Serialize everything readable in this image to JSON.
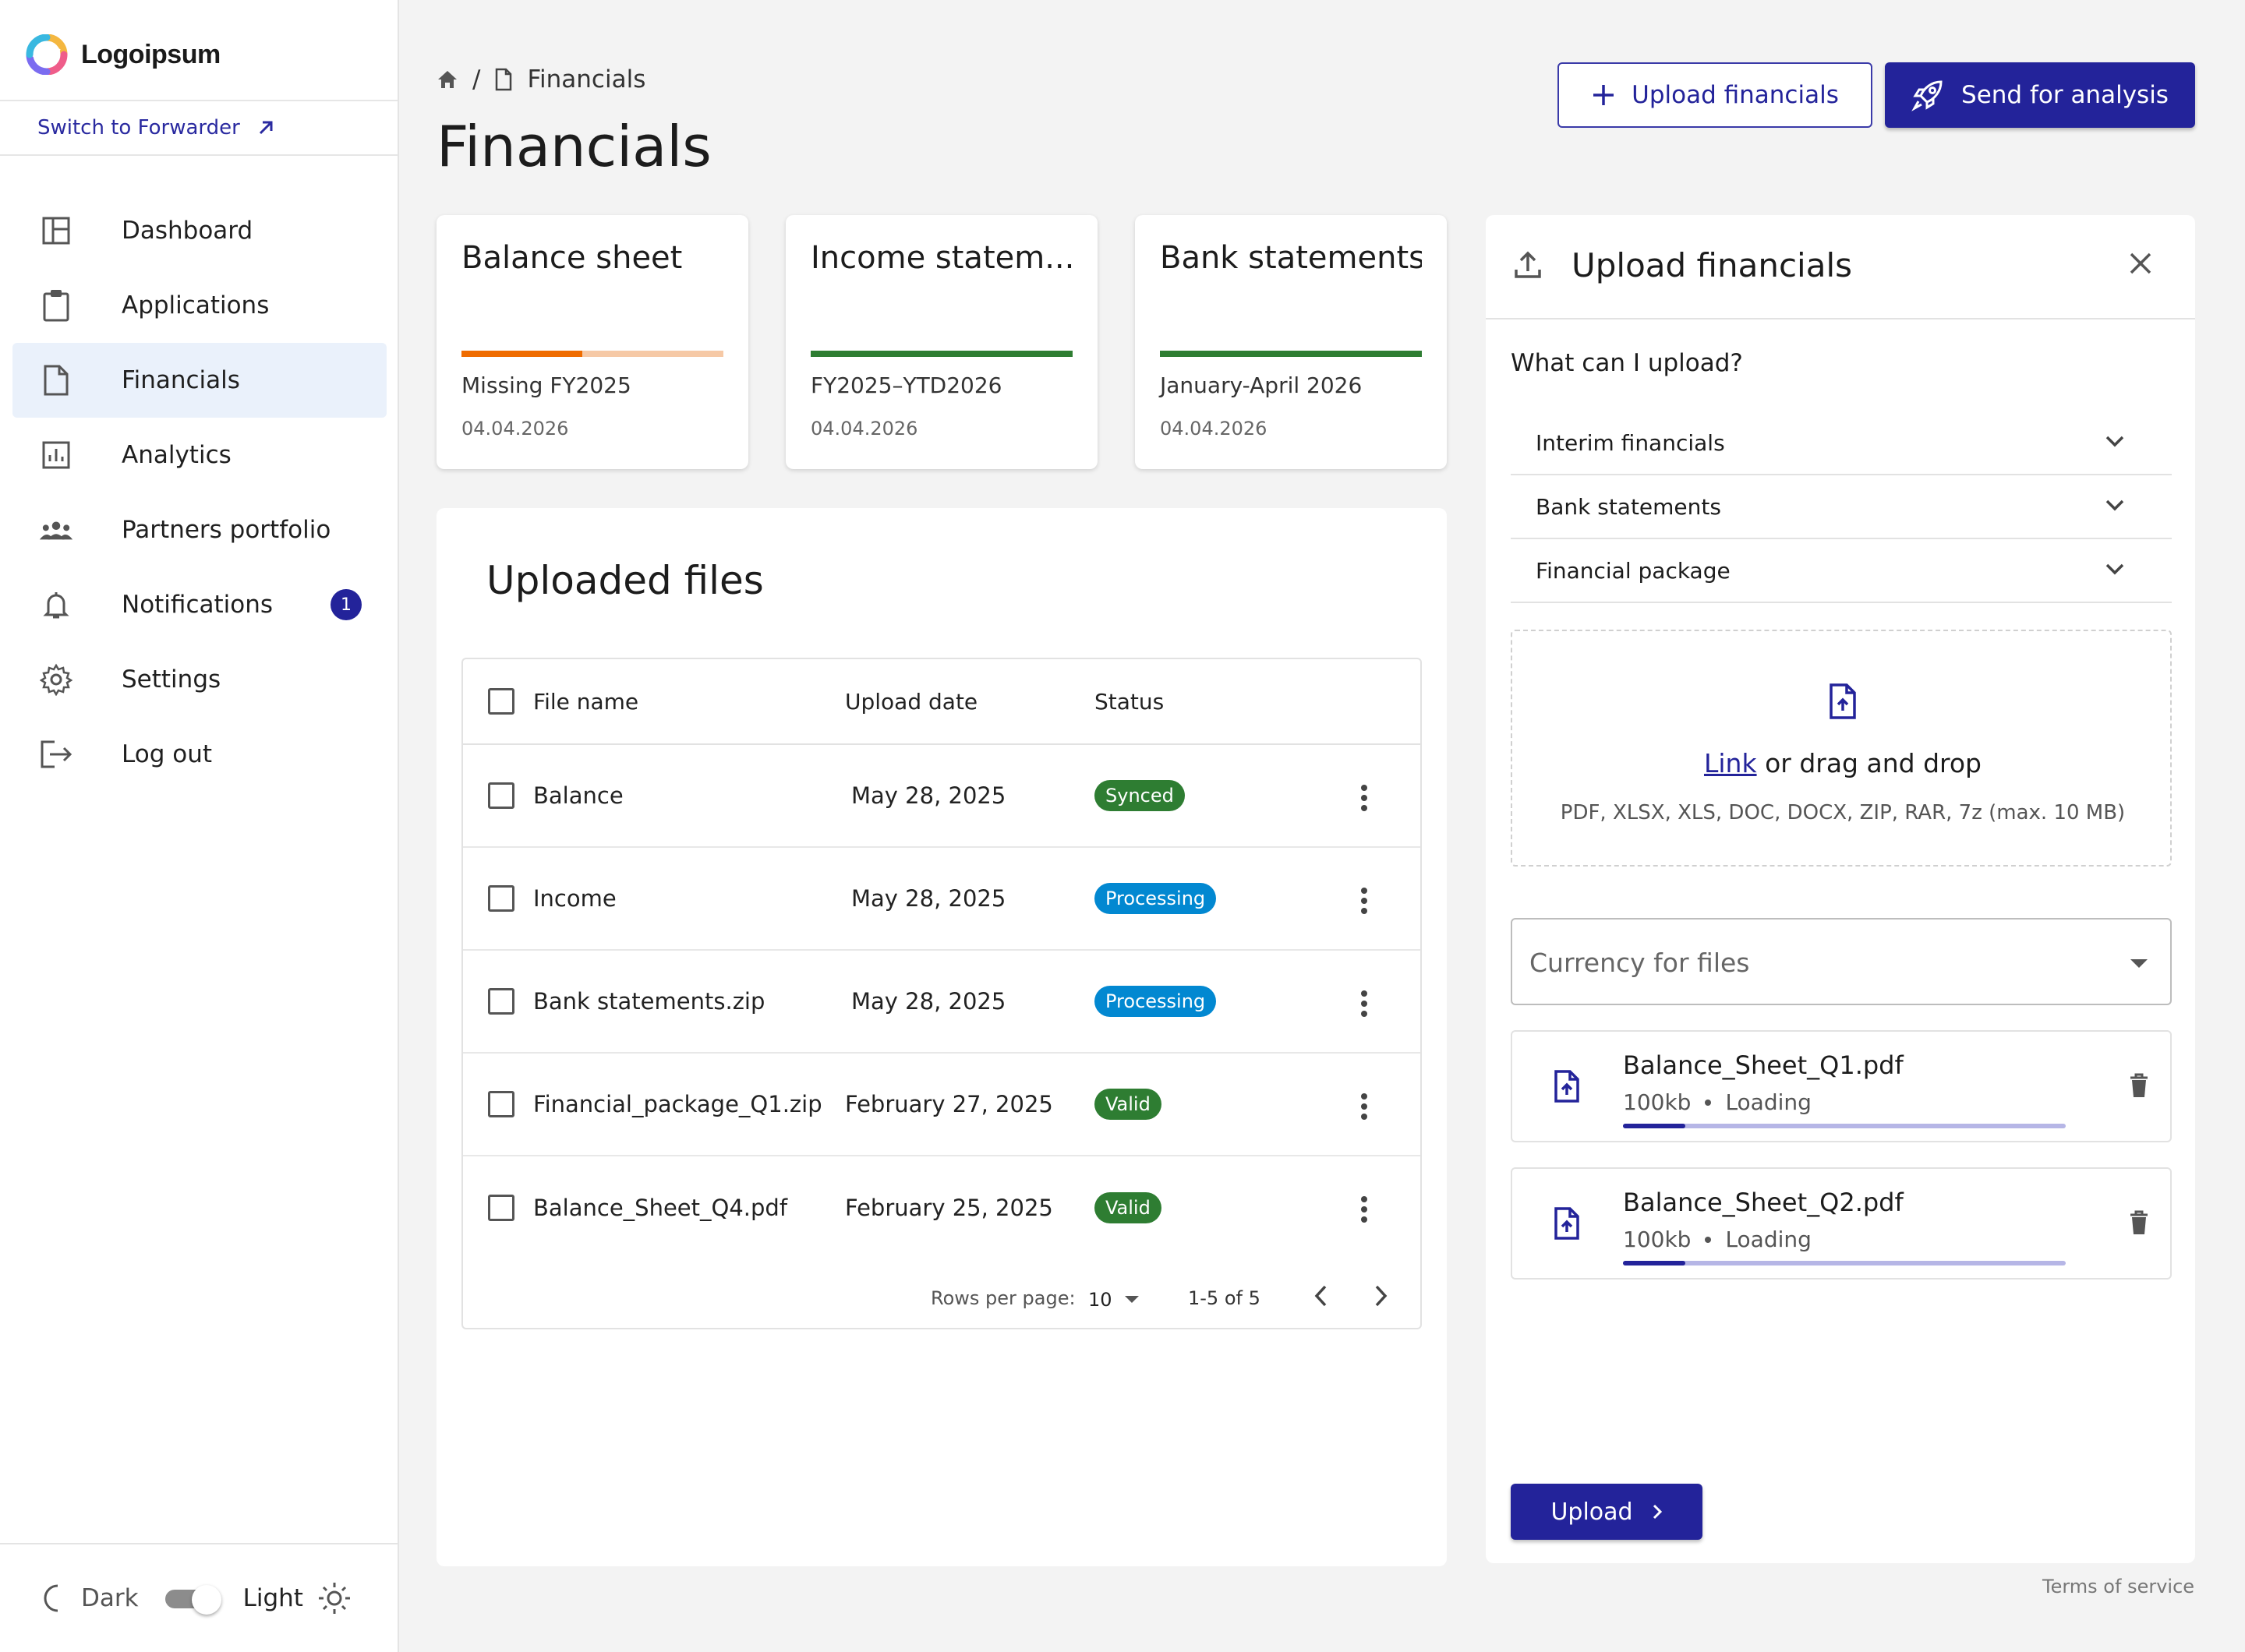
{
  "brand": {
    "name": "Logoipsum"
  },
  "sidebar": {
    "switch_label": "Switch to Forwarder",
    "items": [
      {
        "label": "Dashboard",
        "icon": "dashboard-icon"
      },
      {
        "label": "Applications",
        "icon": "clipboard-icon"
      },
      {
        "label": "Financials",
        "icon": "document-icon",
        "active": true
      },
      {
        "label": "Analytics",
        "icon": "analytics-icon"
      },
      {
        "label": "Partners portfolio",
        "icon": "group-icon"
      },
      {
        "label": "Notifications",
        "icon": "bell-icon",
        "badge": "1"
      },
      {
        "label": "Settings",
        "icon": "gear-icon"
      },
      {
        "label": "Log out",
        "icon": "logout-icon"
      }
    ],
    "theme": {
      "dark_label": "Dark",
      "light_label": "Light"
    }
  },
  "header": {
    "breadcrumb_sep": "/",
    "breadcrumb_current": "Financials",
    "title": "Financials",
    "upload_button": "Upload financials",
    "send_button": "Send for analysis"
  },
  "cards": [
    {
      "title": "Balance sheet",
      "subtitle": "Missing FY2025",
      "date": "04.04.2026",
      "progress": 0.46,
      "color": "#ef6c00"
    },
    {
      "title": "Income statem...",
      "subtitle": "FY2025–YTD2026",
      "date": "04.04.2026",
      "progress": 1.0,
      "color": "#2e7d32"
    },
    {
      "title": "Bank statements",
      "subtitle": "January-April 2026",
      "date": "04.04.2026",
      "progress": 1.0,
      "color": "#2e7d32"
    }
  ],
  "files": {
    "title": "Uploaded files",
    "columns": {
      "name": "File name",
      "date": "Upload date",
      "status": "Status"
    },
    "rows": [
      {
        "name": "Balance",
        "date": "May 28, 2025",
        "status": "Synced"
      },
      {
        "name": "Income",
        "date": "May 28, 2025",
        "status": "Processing"
      },
      {
        "name": "Bank statements.zip",
        "date": "May 28, 2025",
        "status": "Processing"
      },
      {
        "name": "Financial_package_Q1.zip",
        "date": "February 27, 2025",
        "status": "Valid"
      },
      {
        "name": "Balance_Sheet_Q4.pdf",
        "date": "February 25, 2025",
        "status": "Valid"
      }
    ],
    "pager": {
      "rows_per_page_label": "Rows per page:",
      "rows_per_page": "10",
      "range": "1-5 of 5"
    }
  },
  "upload": {
    "title": "Upload financials",
    "question": "What can I upload?",
    "accordion": [
      "Interim financials",
      "Bank statements",
      "Financial package"
    ],
    "drop": {
      "link": "Link",
      "text": " or drag and drop",
      "formats": "PDF, XLSX, XLS, DOC, DOCX, ZIP, RAR, 7z (max. 10 MB)"
    },
    "currency_placeholder": "Currency for files",
    "files": [
      {
        "name": "Balance_Sheet_Q1.pdf",
        "size": "100kb",
        "state": "Loading",
        "progress": 0.14
      },
      {
        "name": "Balance_Sheet_Q2.pdf",
        "size": "100kb",
        "state": "Loading",
        "progress": 0.14
      }
    ],
    "button": "Upload"
  },
  "footer": {
    "terms": "Terms of service"
  },
  "colors": {
    "primary": "#23239a",
    "synced": "#2e7d32",
    "processing": "#0288d1",
    "valid": "#2e7d32"
  }
}
